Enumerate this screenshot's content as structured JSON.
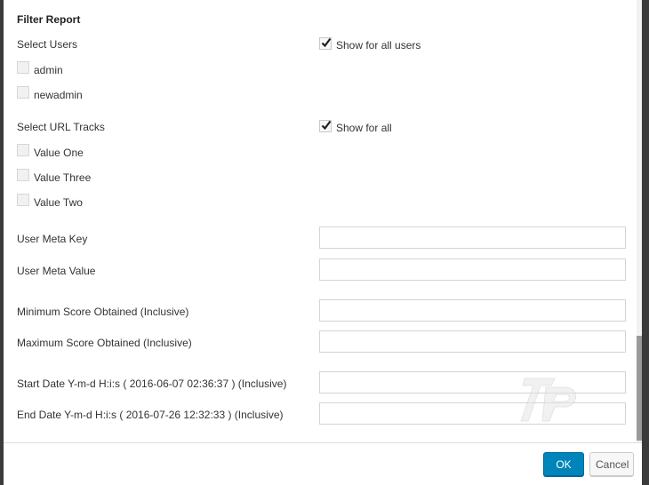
{
  "dialog": {
    "title": "Filter Report",
    "users": {
      "label": "Select Users",
      "show_all_label": "Show for all users",
      "show_all_checked": true,
      "options": [
        {
          "label": "admin",
          "checked": false
        },
        {
          "label": "newadmin",
          "checked": false
        }
      ]
    },
    "tracks": {
      "label": "Select URL Tracks",
      "show_all_label": "Show for all",
      "show_all_checked": true,
      "options": [
        {
          "label": "Value One",
          "checked": false
        },
        {
          "label": "Value Three",
          "checked": false
        },
        {
          "label": "Value Two",
          "checked": false
        }
      ]
    },
    "fields": [
      {
        "label": "User Meta Key",
        "value": ""
      },
      {
        "label": "User Meta Value",
        "value": ""
      },
      {
        "label": "Minimum Score Obtained (Inclusive)",
        "value": ""
      },
      {
        "label": "Maximum Score Obtained (Inclusive)",
        "value": ""
      },
      {
        "label": "Start Date Y-m-d H:i:s ( 2016-06-07 02:36:37 ) (Inclusive)",
        "value": ""
      },
      {
        "label": "End Date Y-m-d H:i:s ( 2016-07-26 12:32:33 ) (Inclusive)",
        "value": ""
      }
    ]
  },
  "footer": {
    "ok_label": "OK",
    "cancel_label": "Cancel"
  },
  "colors": {
    "ok_button": "#0085ba",
    "overlay": "#3b3b3b"
  },
  "icons": {
    "checkmark": "checkmark-icon",
    "watermark": "watermark-logo"
  }
}
